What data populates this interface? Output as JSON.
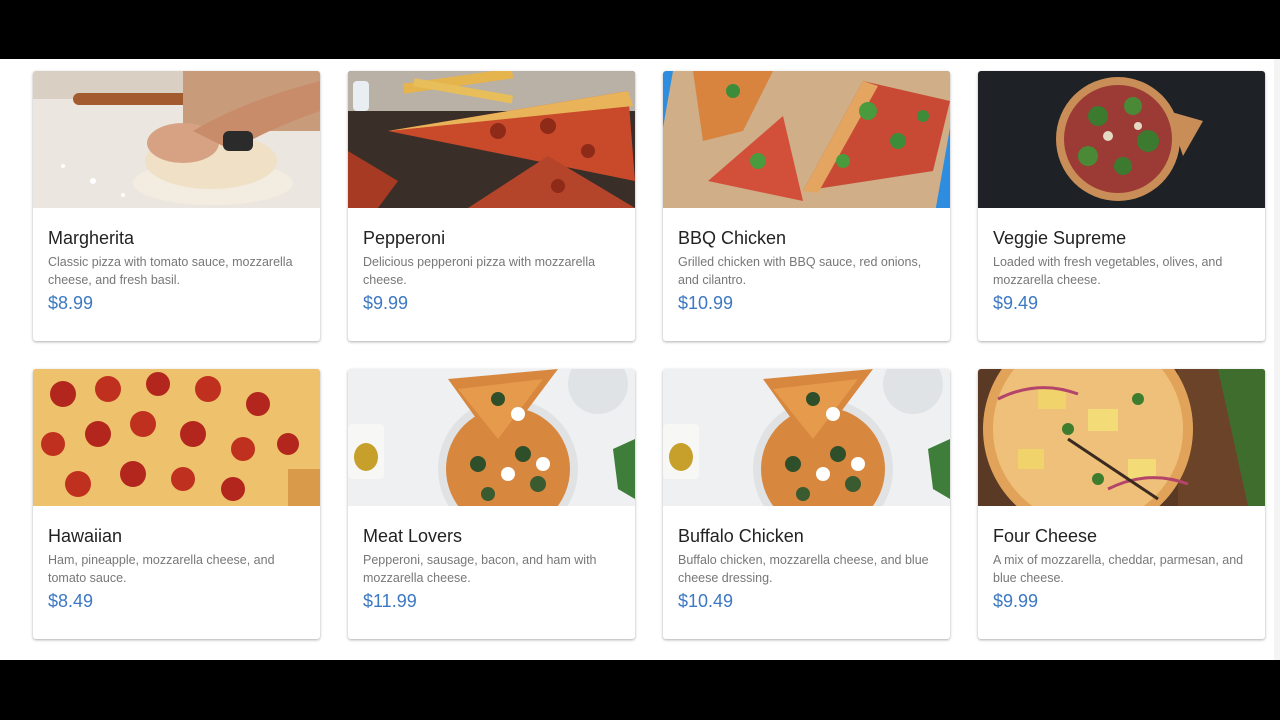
{
  "menu": {
    "items": [
      {
        "name": "Margherita",
        "description": "Classic pizza with tomato sauce, mozzarella cheese, and fresh basil.",
        "price": "$8.99",
        "image": "dough-kneading-photo"
      },
      {
        "name": "Pepperoni",
        "description": "Delicious pepperoni pizza with mozzarella cheese.",
        "price": "$9.99",
        "image": "pizza-slice-with-fries-photo"
      },
      {
        "name": "BBQ Chicken",
        "description": "Grilled chicken with BBQ sauce, red onions, and cilantro.",
        "price": "$10.99",
        "image": "arugula-pizza-on-board-photo"
      },
      {
        "name": "Veggie Supreme",
        "description": "Loaded with fresh vegetables, olives, and mozzarella cheese.",
        "price": "$9.49",
        "image": "veggie-pizza-dark-background-photo"
      },
      {
        "name": "Hawaiian",
        "description": "Ham, pineapple, mozzarella cheese, and tomato sauce.",
        "price": "$8.49",
        "image": "pepperoni-pizza-closeup-photo"
      },
      {
        "name": "Meat Lovers",
        "description": "Pepperoni, sausage, bacon, and ham with mozzarella cheese.",
        "price": "$11.99",
        "image": "spinach-mozzarella-pizza-photo"
      },
      {
        "name": "Buffalo Chicken",
        "description": "Buffalo chicken, mozzarella cheese, and blue cheese dressing.",
        "price": "$10.49",
        "image": "spinach-mozzarella-pizza-photo"
      },
      {
        "name": "Four Cheese",
        "description": "A mix of mozzarella, cheddar, parmesan, and blue cheese.",
        "price": "$9.99",
        "image": "loaded-pizza-wood-board-photo"
      }
    ]
  },
  "colors": {
    "price": "#3c78c3",
    "title": "#222222",
    "description": "#777777",
    "letterbox": "#000000"
  }
}
